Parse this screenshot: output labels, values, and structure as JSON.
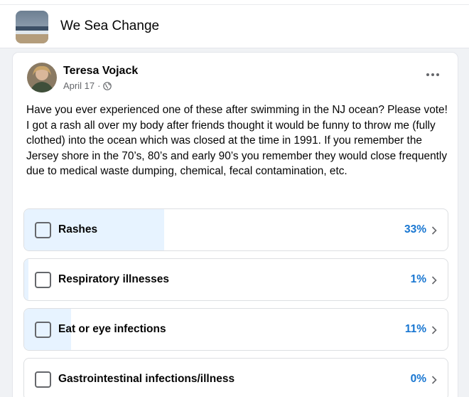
{
  "group": {
    "name": "We Sea Change"
  },
  "post": {
    "author": "Teresa Vojack",
    "date": "April 17",
    "separator": "·",
    "body": "Have you ever experienced one of these after swimming in the NJ ocean? Please vote! I got a rash all over my body after friends thought it would be funny to throw me (fully clothed) into the ocean which was closed at the time in 1991. If you remember the Jersey shore in the 70’s, 80’s and early 90’s you remember they would close frequently due to medical waste dumping, chemical, fecal contamination, etc."
  },
  "poll": {
    "options": [
      {
        "label": "Rashes",
        "percent": "33%",
        "fraction": 0.33
      },
      {
        "label": "Respiratory illnesses",
        "percent": "1%",
        "fraction": 0.01
      },
      {
        "label": "Eat or eye infections",
        "percent": "11%",
        "fraction": 0.11
      },
      {
        "label": "Gastrointestinal infections/illness",
        "percent": "0%",
        "fraction": 0.0
      }
    ]
  },
  "colors": {
    "percent_text": "#1876d1",
    "poll_fill": "#e7f3ff",
    "meta_text": "#65676b"
  },
  "icons": {
    "more": "more-options-icon",
    "audience": "globe-icon",
    "chevron": "chevron-right-icon"
  }
}
